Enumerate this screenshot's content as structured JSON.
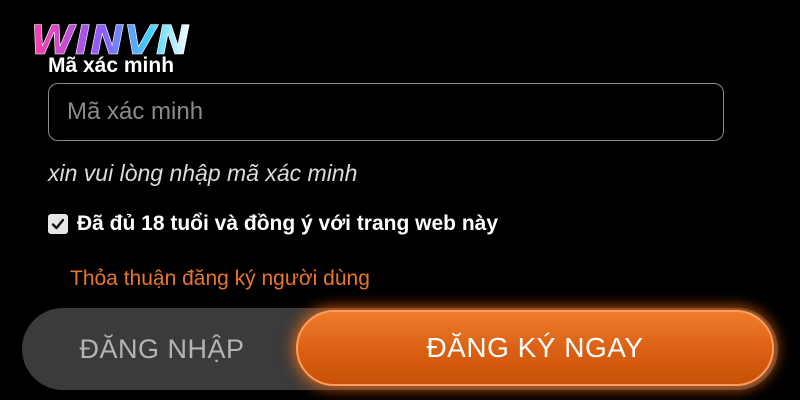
{
  "logo": {
    "text": "WINVN",
    "colors": [
      "#ff3ea5",
      "#8b5cff",
      "#3fd0ff",
      "#ffffff"
    ]
  },
  "verification": {
    "label": "Mã xác minh",
    "placeholder": "Mã xác minh",
    "value": "",
    "hint": "xin vui lòng nhập mã xác minh"
  },
  "agreement": {
    "checked": true,
    "text": "Đã đủ 18 tuổi và đồng ý với trang web này",
    "terms_link": "Thỏa thuận đăng ký người dùng"
  },
  "actions": {
    "login_label": "ĐĂNG NHẬP",
    "register_label": "ĐĂNG KÝ NGAY"
  },
  "colors": {
    "accent": "#e8762b",
    "button_orange": "#d95f12",
    "bar_gray": "#3b3b3b",
    "background": "#000000"
  },
  "icons": {
    "checkbox": "check-icon"
  }
}
